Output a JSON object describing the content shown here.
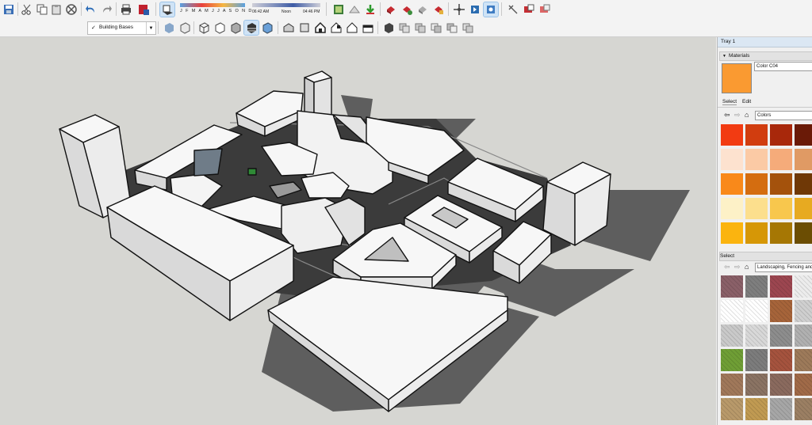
{
  "toolbar": {
    "shadow_months": "J F M A M J J A S O N D",
    "time_start": "06:42 AM",
    "time_noon": "Noon",
    "time_end": "04:46 PM",
    "layer_selected": "Building Bases",
    "layer_checked": "✓"
  },
  "tray": {
    "title": "Tray 1",
    "materials_header": "Materials",
    "collapse_glyph": "▼",
    "material_name": "Color C04",
    "material_color": "#fa9a31",
    "tab_select": "Select",
    "tab_edit": "Edit",
    "colors_collection": "Colors",
    "secondary_select_label": "Select",
    "secondary_collection": "Landscaping, Fencing and Vegetation",
    "colors": [
      [
        "#f23b12",
        "#d13d0f",
        "#a8280b",
        "#6a1a07"
      ],
      [
        "#fde2cf",
        "#fbcaa5",
        "#f5ab7a",
        "#e09a64"
      ],
      [
        "#f9891a",
        "#d46d10",
        "#a4520c",
        "#6f3806"
      ],
      [
        "#fdf1c7",
        "#fcdf8d",
        "#f8c74d",
        "#e7aa21"
      ],
      [
        "#fbb40f",
        "#d69706",
        "#a67704",
        "#6b4d03"
      ]
    ],
    "textures": [
      [
        "#8a6068",
        "#7e7e7e",
        "#9c4650",
        "#ececec"
      ],
      [
        "#ffffff",
        "#ffffff",
        "#a6643a",
        "#cfcfcf"
      ],
      [
        "#c9c9c9",
        "#d8d8d8",
        "#8d8d8d",
        "#b0b0b0"
      ],
      [
        "#6f9e35",
        "#7c7c7c",
        "#a5533e",
        "#9d7a5a"
      ],
      [
        "#a0785a",
        "#8a7363",
        "#8a6a5e",
        "#a06a48"
      ],
      [
        "#b8996a",
        "#c09a52",
        "#a6a6a6",
        "#9b7f63"
      ]
    ]
  }
}
